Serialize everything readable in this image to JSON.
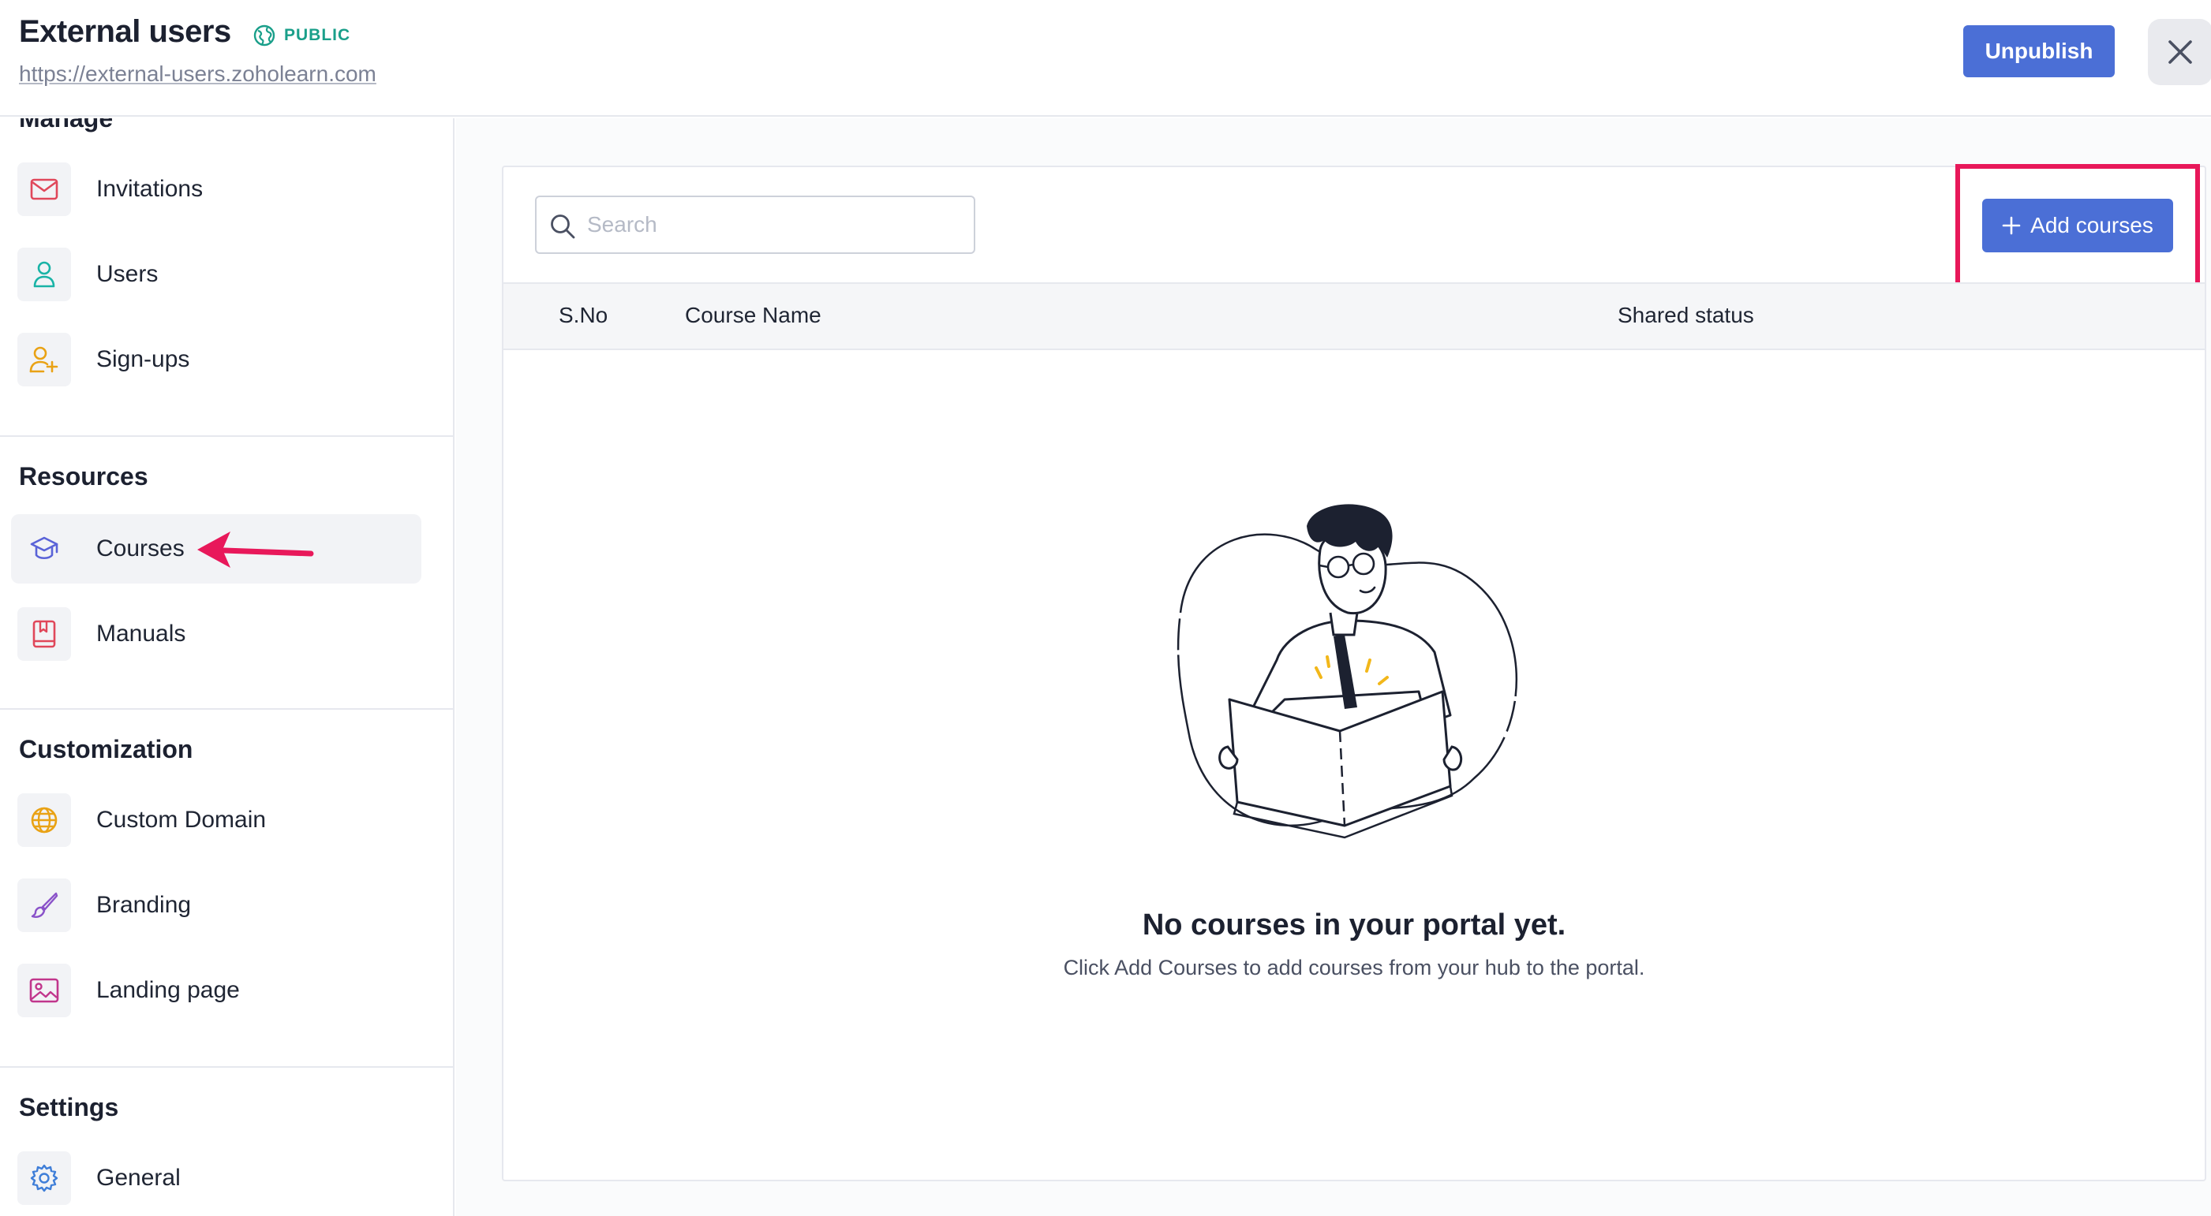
{
  "header": {
    "title": "External users",
    "badge": "PUBLIC",
    "url": "https://external-users.zoholearn.com",
    "unpublish_label": "Unpublish"
  },
  "sidebar": {
    "sections": [
      {
        "title": "Manage",
        "items": [
          {
            "label": "Invitations",
            "icon": "mail-icon"
          },
          {
            "label": "Users",
            "icon": "user-icon"
          },
          {
            "label": "Sign-ups",
            "icon": "user-plus-icon"
          }
        ]
      },
      {
        "title": "Resources",
        "items": [
          {
            "label": "Courses",
            "icon": "graduation-cap-icon"
          },
          {
            "label": "Manuals",
            "icon": "book-icon"
          }
        ]
      },
      {
        "title": "Customization",
        "items": [
          {
            "label": "Custom Domain",
            "icon": "globe-icon"
          },
          {
            "label": "Branding",
            "icon": "paintbrush-icon"
          },
          {
            "label": "Landing page",
            "icon": "image-icon"
          }
        ]
      },
      {
        "title": "Settings",
        "items": [
          {
            "label": "General",
            "icon": "gear-icon"
          }
        ]
      }
    ],
    "active_item": "Courses"
  },
  "main": {
    "search": {
      "placeholder": "Search",
      "value": ""
    },
    "add_button_label": "Add courses",
    "table": {
      "columns": [
        "S.No",
        "Course Name",
        "Shared status"
      ]
    },
    "empty_state": {
      "title": "No courses in your portal yet.",
      "subtitle": "Click Add Courses to add courses from your hub to the portal."
    }
  },
  "colors": {
    "primary": "#4b6fd6",
    "highlight": "#e8185a",
    "public_badge": "#1a9f8a"
  }
}
